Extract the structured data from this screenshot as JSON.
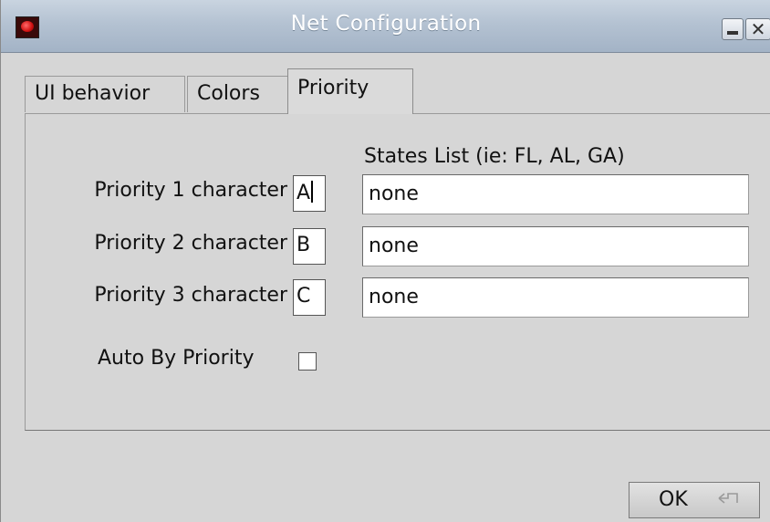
{
  "window": {
    "title": "Net Configuration"
  },
  "tabs": [
    {
      "label": "UI behavior",
      "active": false
    },
    {
      "label": "Colors",
      "active": false
    },
    {
      "label": "Priority",
      "active": true
    }
  ],
  "priority": {
    "states_header": "States List (ie: FL, AL, GA)",
    "rows": [
      {
        "label": "Priority 1 character",
        "char": "A",
        "states": "none"
      },
      {
        "label": "Priority 2 character",
        "char": "B",
        "states": "none"
      },
      {
        "label": "Priority 3 character",
        "char": "C",
        "states": "none"
      }
    ],
    "auto_label": "Auto By Priority",
    "auto_checked": false
  },
  "buttons": {
    "ok_label": "OK"
  },
  "icons": {
    "app": "app-icon",
    "minimize": "minimize-icon",
    "close": "close-icon",
    "enter": "enter-key-icon"
  }
}
